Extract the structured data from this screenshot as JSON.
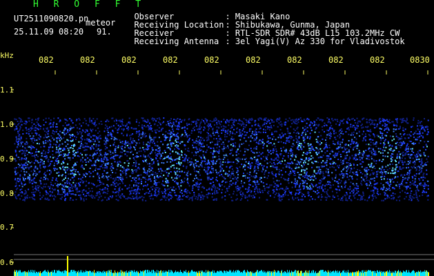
{
  "header": {
    "app_title": "H R O F F T",
    "file_name": "UT2511090820.pn",
    "file_suffix": "meteor",
    "date_time": "25.11.09 08:20",
    "count": "91."
  },
  "info": [
    {
      "label": "Observer",
      "value": ": Masaki Kano"
    },
    {
      "label": "Receiving Location",
      "value": ": Shibukawa, Gunma, Japan"
    },
    {
      "label": "Receiver",
      "value": ": RTL-SDR SDR# 43dB L15 103.2MHz CW"
    },
    {
      "label": "Receiving Antenna",
      "value": ": 3el Yagi(V) Az 330 for Vladivostok"
    }
  ],
  "axis": {
    "unit": "kHz",
    "time_ticks": [
      "082",
      "082",
      "082",
      "082",
      "082",
      "082",
      "082",
      "082",
      "082",
      "0830"
    ],
    "freq_ticks": [
      "1.1",
      "1.0",
      "0.9",
      "0.8",
      "0.7",
      "0.6"
    ]
  },
  "colors": {
    "header_green": "#33ff33",
    "label_yellow": "#ffff66",
    "signal_blue": "#1e3cff",
    "signal_cyan": "#66e6ff",
    "level_cyan": "#00e5ff",
    "level_yellow": "#ffff00"
  }
}
